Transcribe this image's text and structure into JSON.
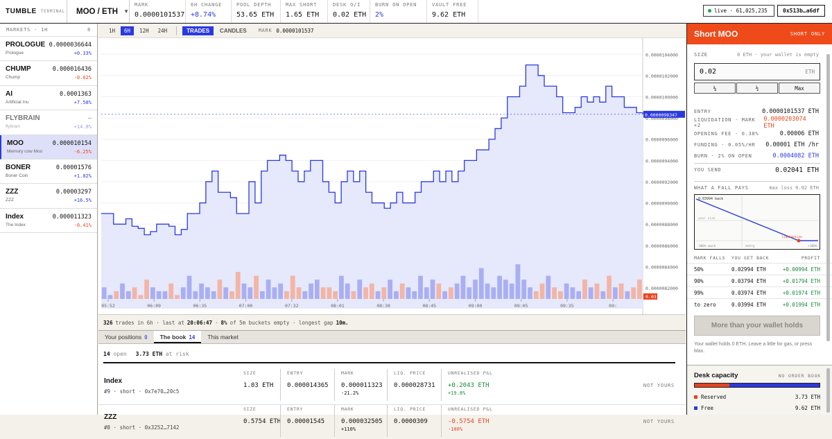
{
  "topbar": {
    "brand": "TUMBLE",
    "brand_sub": "TERMINAL",
    "pair": "MOO / ETH",
    "stats": [
      {
        "label": "MARK",
        "value": "0.0000101537"
      },
      {
        "label": "6H CHANGE",
        "value": "+8.74%"
      },
      {
        "label": "POOL DEPTH",
        "value": "53.65 ETH"
      },
      {
        "label": "MAX SHORT",
        "value": "1.65 ETH"
      },
      {
        "label": "DESK O/I",
        "value": "0.02 ETH"
      },
      {
        "label": "BURN ON OPEN",
        "value": "2%"
      },
      {
        "label": "VAULT FREE",
        "value": "9.62 ETH"
      }
    ],
    "live": "live · 61,025,235",
    "wallet": "0x513b…a6df"
  },
  "markets": {
    "header": "MARKETS · 1H",
    "count": "8",
    "items": [
      {
        "name": "PROLOGUE",
        "sub": "Prologue",
        "price": "0.0000036644",
        "change": "+0.33%"
      },
      {
        "name": "CHUMP",
        "sub": "Chump",
        "price": "0.000016436",
        "change": "-0.02%"
      },
      {
        "name": "AI",
        "sub": "Artificial Inu",
        "price": "0.0001363",
        "change": "+7.58%"
      },
      {
        "name": "FLYBRAIN",
        "sub": "flybrain",
        "price": "–",
        "change": "+14.8%"
      },
      {
        "name": "MOO",
        "sub": "Memory cow Moo",
        "price": "0.000010154",
        "change": "-6.25%"
      },
      {
        "name": "BONER",
        "sub": "Boner Coin",
        "price": "0.00001576",
        "change": "+1.82%"
      },
      {
        "name": "ZZZ",
        "sub": "ZZZ",
        "price": "0.00003297",
        "change": "+16.5%"
      },
      {
        "name": "Index",
        "sub": "The Index",
        "price": "0.000011323",
        "change": "-0.41%"
      }
    ]
  },
  "toolbar": {
    "timeframes": [
      "1H",
      "6H",
      "12H",
      "24H"
    ],
    "modes": [
      "TRADES",
      "CANDLES"
    ],
    "mark_label": "MARK",
    "mark_value": "0.0000101537"
  },
  "chart_data": {
    "type": "line",
    "x_ticks": [
      "05:52",
      "06:09",
      "06:35",
      "07:00",
      "07:32",
      "08:01",
      "08:30",
      "08:45",
      "09:00",
      "09:05",
      "09:35",
      "09:"
    ],
    "y_ticks": [
      "0.0000104000",
      "0.0000102000",
      "0.0000100000",
      "0.0000098000",
      "0.0000096000",
      "0.0000094000",
      "0.0000092000",
      "0.0000090000",
      "0.0000088000",
      "0.0000086000",
      "0.0000084000",
      "0.0000082000"
    ],
    "ylim": [
      8.2e-06,
      1.05e-05
    ],
    "current_label": "0.0000098347",
    "volume_max_label": "0.03",
    "price": [
      8.9e-06,
      8.9e-06,
      8.8e-06,
      8.8e-06,
      8.85e-06,
      8.78e-06,
      8.76e-06,
      8.7e-06,
      8.73e-06,
      8.8e-06,
      8.8e-06,
      8.78e-06,
      8.7e-06,
      8.75e-06,
      8.9e-06,
      8.9e-06,
      9e-06,
      9.2e-06,
      9.3e-06,
      9.1e-06,
      9.1e-06,
      9.05e-06,
      8.9e-06,
      8.9e-06,
      9.2e-06,
      9e-06,
      9.3e-06,
      9.4e-06,
      9.4e-06,
      9.45e-06,
      9.4e-06,
      9.3e-06,
      9.2e-06,
      9.3e-06,
      9.4e-06,
      9.4e-06,
      9.2e-06,
      9.1e-06,
      9e-06,
      9.2e-06,
      9.3e-06,
      9.2e-06,
      9.3e-06,
      9.1e-06,
      9e-06,
      9e-06,
      8.95e-06,
      9e-06,
      9.1e-06,
      9e-06,
      9e-06,
      9.1e-06,
      9.2e-06,
      9.2e-06,
      9.3e-06,
      9.2e-06,
      9.3e-06,
      9.2e-06,
      9.3e-06,
      9.4e-06,
      9.4e-06,
      9.5e-06,
      9.5e-06,
      9.6e-06,
      9.7e-06,
      9.8e-06,
      1e-05,
      1e-05,
      1.01e-05,
      1.03e-05,
      1.03e-05,
      1.02e-05,
      1.01e-05,
      1.01e-05,
      1e-05,
      9.85e-06,
      9.85e-06,
      9.9e-06,
      1e-05,
      9.95e-06,
      1e-05,
      9.95e-06,
      1.01e-05,
      1e-05,
      1e-05,
      9.9e-06,
      9.9e-06,
      9.85e-06,
      9.8347e-06
    ],
    "volume": [
      3,
      1,
      2,
      4,
      2,
      3,
      1,
      5,
      3,
      2,
      2,
      4,
      1,
      3,
      6,
      2,
      4,
      3,
      2,
      5,
      3,
      2,
      7,
      4,
      3,
      6,
      2,
      5,
      3,
      4,
      2,
      6,
      3,
      2,
      4,
      5,
      3,
      3,
      2,
      6,
      4,
      2,
      5,
      3,
      4,
      2,
      3,
      5,
      2,
      4,
      3,
      2,
      6,
      3,
      5,
      4,
      2,
      3,
      4,
      6,
      3,
      5,
      8,
      4,
      3,
      6,
      5,
      4,
      9,
      5,
      3,
      2,
      4,
      6,
      3,
      2,
      4,
      3,
      2,
      5,
      3,
      4,
      2,
      6,
      3,
      4,
      2,
      3,
      5
    ]
  },
  "chart_stats": {
    "trades": "326",
    "trades_suffix": "trades in 6h · last at",
    "last_time": "20:06:47",
    "empty_pct": "8%",
    "empty_suffix": "of 5m buckets empty · longest gap",
    "gap": "10m."
  },
  "tabs": [
    {
      "label": "Your positions",
      "count": "0"
    },
    {
      "label": "The book",
      "count": "14"
    },
    {
      "label": "This market",
      "count": ""
    }
  ],
  "book": {
    "open_count": "14",
    "open_label": "open",
    "risk_value": "3.73 ETH",
    "risk_label": "at risk",
    "positions": [
      {
        "name": "Index",
        "meta": "#9 · short · 0x7e70…20c5",
        "size": "1.03 ETH",
        "entry": "0.000014365",
        "mark": "0.000011323",
        "mark_sub": "-21.2%",
        "liq": "0.000028731",
        "pnl": "+0.2043 ETH",
        "pnl_sub": "+19.8%",
        "owner": "NOT YOURS"
      },
      {
        "name": "ZZZ",
        "meta": "#8 · short · 0x3252…7142",
        "size": "0.5754 ETH",
        "entry": "0.00001545",
        "mark": "0.000032505",
        "mark_sub": "+110%",
        "liq": "0.0000309",
        "pnl": "-0.5754 ETH",
        "pnl_sub": "-100%",
        "owner": "NOT YOURS"
      }
    ],
    "col_labels": {
      "size": "SIZE",
      "entry": "ENTRY",
      "mark": "MARK",
      "liq": "LIQ. PRICE",
      "pnl": "UNREALISED P&L"
    }
  },
  "order": {
    "title": "Short MOO",
    "badge": "SHORT ONLY",
    "size_label": "SIZE",
    "size_hint": "0 ETH · your wallet is empty",
    "size_value": "0.02",
    "size_unit": "ETH",
    "quick": [
      "¼",
      "½",
      "Max"
    ],
    "rows": [
      {
        "label": "ENTRY",
        "value": "0.0000101537 ETH"
      },
      {
        "label": "LIQUIDATION · MARK ×2",
        "value": "0.0000203074 ETH"
      },
      {
        "label": "OPENING FEE · 0.38%",
        "value": "0.00006 ETH"
      },
      {
        "label": "FUNDING · 0.05%/HR",
        "value": "0.00001 ETH /hr"
      },
      {
        "label": "BURN · 2% ON OPEN",
        "value": "0.0004082 ETH"
      }
    ],
    "send_label": "YOU SEND",
    "send_value": "0.02041 ETH",
    "fall_label": "WHAT A FALL PAYS",
    "fall_hint": "max loss 0.02 ETH",
    "mini": {
      "top": "0.03994 back",
      "mid": "your size",
      "left": "-100% mark",
      "center": "entry",
      "right": "+100%",
      "liq": "liquidation"
    },
    "falls_head": [
      "MARK FALLS",
      "YOU GET BACK",
      "PROFIT"
    ],
    "falls": [
      {
        "fall": "50%",
        "back": "0.02994 ETH",
        "profit": "+0.00994 ETH"
      },
      {
        "fall": "90%",
        "back": "0.03794 ETH",
        "profit": "+0.01794 ETH"
      },
      {
        "fall": "99%",
        "back": "0.03974 ETH",
        "profit": "+0.01974 ETH"
      },
      {
        "fall": "to zero",
        "back": "0.03994 ETH",
        "profit": "+0.01994 ETH"
      }
    ],
    "button": "More than your wallet holds",
    "hint": "Your wallet holds 0 ETH. Leave a little for gas, or press Max."
  },
  "capacity": {
    "title": "Desk capacity",
    "badge": "NO ORDER BOOK",
    "reserved_label": "Reserved",
    "reserved_value": "3.73 ETH",
    "free_label": "Free",
    "free_value": "9.62 ETH",
    "reserved_fraction": 0.28
  }
}
